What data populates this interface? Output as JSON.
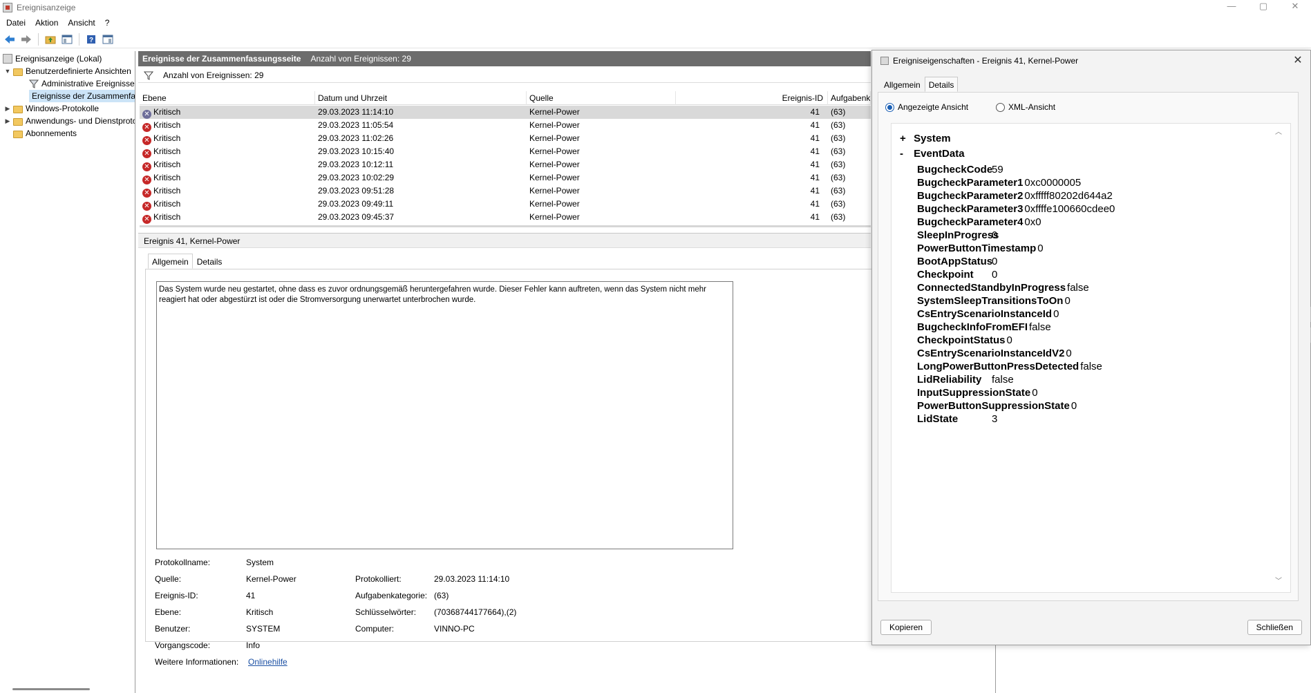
{
  "window": {
    "title": "Ereignisanzeige",
    "controls": [
      "—",
      "▢",
      "✕"
    ]
  },
  "menu": [
    "Datei",
    "Aktion",
    "Ansicht",
    "?"
  ],
  "tree": {
    "root": "Ereignisanzeige (Lokal)",
    "custom_views": "Benutzerdefinierte Ansichten",
    "admin_events": "Administrative Ereignisse",
    "summary_events": "Ereignisse der Zusammenfassungsseite",
    "windows_logs": "Windows-Protokolle",
    "app_logs": "Anwendungs- und Dienstprotokolle",
    "subscriptions": "Abonnements"
  },
  "summary": {
    "title": "Ereignisse der Zusammenfassungsseite",
    "count_label": "Anzahl von Ereignissen: 29",
    "filter_text": "Anzahl von Ereignissen: 29"
  },
  "grid": {
    "headers": [
      "Ebene",
      "Datum und Uhrzeit",
      "Quelle",
      "Ereignis-ID",
      "Aufgabenkategorie"
    ],
    "rows": [
      [
        "Kritisch",
        "29.03.2023 11:14:10",
        "Kernel-Power",
        "41",
        "(63)"
      ],
      [
        "Kritisch",
        "29.03.2023 11:05:54",
        "Kernel-Power",
        "41",
        "(63)"
      ],
      [
        "Kritisch",
        "29.03.2023 11:02:26",
        "Kernel-Power",
        "41",
        "(63)"
      ],
      [
        "Kritisch",
        "29.03.2023 10:15:40",
        "Kernel-Power",
        "41",
        "(63)"
      ],
      [
        "Kritisch",
        "29.03.2023 10:12:11",
        "Kernel-Power",
        "41",
        "(63)"
      ],
      [
        "Kritisch",
        "29.03.2023 10:02:29",
        "Kernel-Power",
        "41",
        "(63)"
      ],
      [
        "Kritisch",
        "29.03.2023 09:51:28",
        "Kernel-Power",
        "41",
        "(63)"
      ],
      [
        "Kritisch",
        "29.03.2023 09:49:11",
        "Kernel-Power",
        "41",
        "(63)"
      ],
      [
        "Kritisch",
        "29.03.2023 09:45:37",
        "Kernel-Power",
        "41",
        "(63)"
      ]
    ]
  },
  "event": {
    "header": "Ereignis 41, Kernel-Power",
    "tabs": [
      "Allgemein",
      "Details"
    ],
    "description": "Das System wurde neu gestartet, ohne dass es zuvor ordnungsgemäß heruntergefahren wurde. Dieser Fehler kann auftreten, wenn das System nicht mehr reagiert hat oder abgestürzt ist oder die Stromversorgung unerwartet unterbrochen wurde.",
    "props": {
      "log_name_label": "Protokollname:",
      "log_name": "System",
      "source_label": "Quelle:",
      "source": "Kernel-Power",
      "logged_label": "Protokolliert:",
      "logged": "29.03.2023 11:14:10",
      "event_id_label": "Ereignis-ID:",
      "event_id": "41",
      "task_label": "Aufgabenkategorie:",
      "task": "(63)",
      "level_label": "Ebene:",
      "level": "Kritisch",
      "keywords_label": "Schlüsselwörter:",
      "keywords": "(70368744177664),(2)",
      "user_label": "Benutzer:",
      "user": "SYSTEM",
      "computer_label": "Computer:",
      "computer": "VINNO-PC",
      "opcode_label": "Vorgangscode:",
      "opcode": "Info",
      "more_label": "Weitere Informationen:",
      "more_link": "Onlinehilfe"
    }
  },
  "dialog": {
    "title": "Ereigniseigenschaften - Ereignis 41, Kernel-Power",
    "tabs": [
      "Allgemein",
      "Details"
    ],
    "radio_display": "Angezeigte Ansicht",
    "radio_xml": "XML-Ansicht",
    "system_label": "System",
    "system_toggle": "+",
    "eventdata_label": "EventData",
    "eventdata_toggle": "-",
    "fields": [
      [
        "BugcheckCode",
        "59"
      ],
      [
        "BugcheckParameter1",
        "0xc0000005"
      ],
      [
        "BugcheckParameter2",
        "0xfffff80202d644a2"
      ],
      [
        "BugcheckParameter3",
        "0xffffe100660cdee0"
      ],
      [
        "BugcheckParameter4",
        "0x0"
      ],
      [
        "SleepInProgress",
        "0"
      ],
      [
        "PowerButtonTimestamp",
        "0"
      ],
      [
        "BootAppStatus",
        "0"
      ],
      [
        "Checkpoint",
        "0"
      ],
      [
        "ConnectedStandbyInProgress",
        "false"
      ],
      [
        "SystemSleepTransitionsToOn",
        "0"
      ],
      [
        "CsEntryScenarioInstanceId",
        "0"
      ],
      [
        "BugcheckInfoFromEFI",
        "false"
      ],
      [
        "CheckpointStatus",
        "0"
      ],
      [
        "CsEntryScenarioInstanceIdV2",
        "0"
      ],
      [
        "LongPowerButtonPressDetected",
        "false"
      ],
      [
        "LidReliability",
        "false"
      ],
      [
        "InputSuppressionState",
        "0"
      ],
      [
        "PowerButtonSuppressionState",
        "0"
      ],
      [
        "LidState",
        "3"
      ]
    ],
    "copy_button": "Kopieren",
    "close_button": "Schließen"
  }
}
